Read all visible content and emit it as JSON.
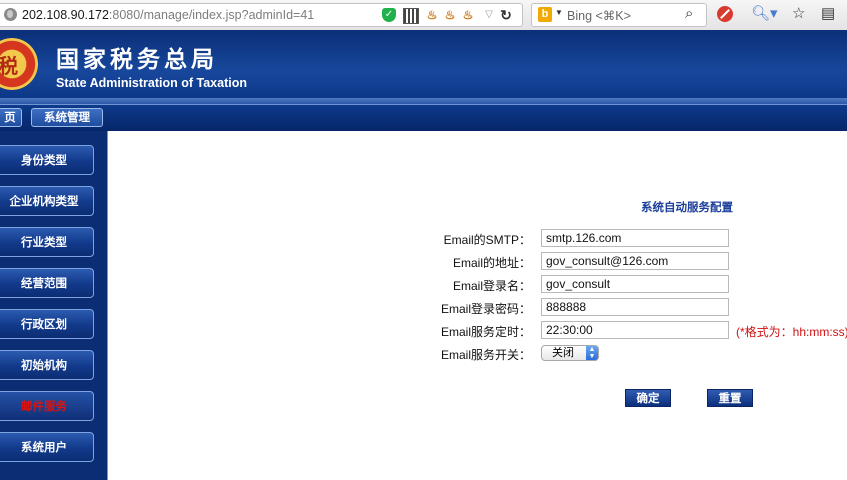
{
  "browser": {
    "url_host": "202.108.90.172",
    "url_path": ":8080/manage/index.jsp?adminId=41",
    "search_placeholder": "Bing <⌘K>"
  },
  "header": {
    "title_cn": "国家税务总局",
    "title_en": "State Administration of Taxation",
    "emblem_text": "税"
  },
  "topnav": {
    "items": [
      {
        "label": "页"
      },
      {
        "label": "系统管理"
      }
    ]
  },
  "sidebar": {
    "items": [
      {
        "label": "身份类型",
        "active": false
      },
      {
        "label": "企业机构类型",
        "active": false
      },
      {
        "label": "行业类型",
        "active": false
      },
      {
        "label": "经营范围",
        "active": false
      },
      {
        "label": "行政区划",
        "active": false
      },
      {
        "label": "初始机构",
        "active": false
      },
      {
        "label": "邮件服务",
        "active": true
      },
      {
        "label": "系统用户",
        "active": false
      }
    ]
  },
  "form": {
    "title": "系统自动服务配置",
    "fields": [
      {
        "label": "Email的SMTP：",
        "value": "smtp.126.com"
      },
      {
        "label": "Email的地址：",
        "value": "gov_consult@126.com"
      },
      {
        "label": "Email登录名：",
        "value": "gov_consult"
      },
      {
        "label": "Email登录密码：",
        "value": "888888"
      },
      {
        "label": "Email服务定时：",
        "value": "22:30:00"
      }
    ],
    "time_hint": "(*格式为：hh:mm:ss)",
    "switch_label": "Email服务开关：",
    "switch_value": "关闭",
    "confirm_label": "确定",
    "reset_label": "重置"
  },
  "colors": {
    "header_blue": "#17479c",
    "sidebar_blue": "#0b2d73",
    "active_red": "#d81414",
    "form_title_blue": "#1c3f9b",
    "hint_red": "#d01010"
  }
}
